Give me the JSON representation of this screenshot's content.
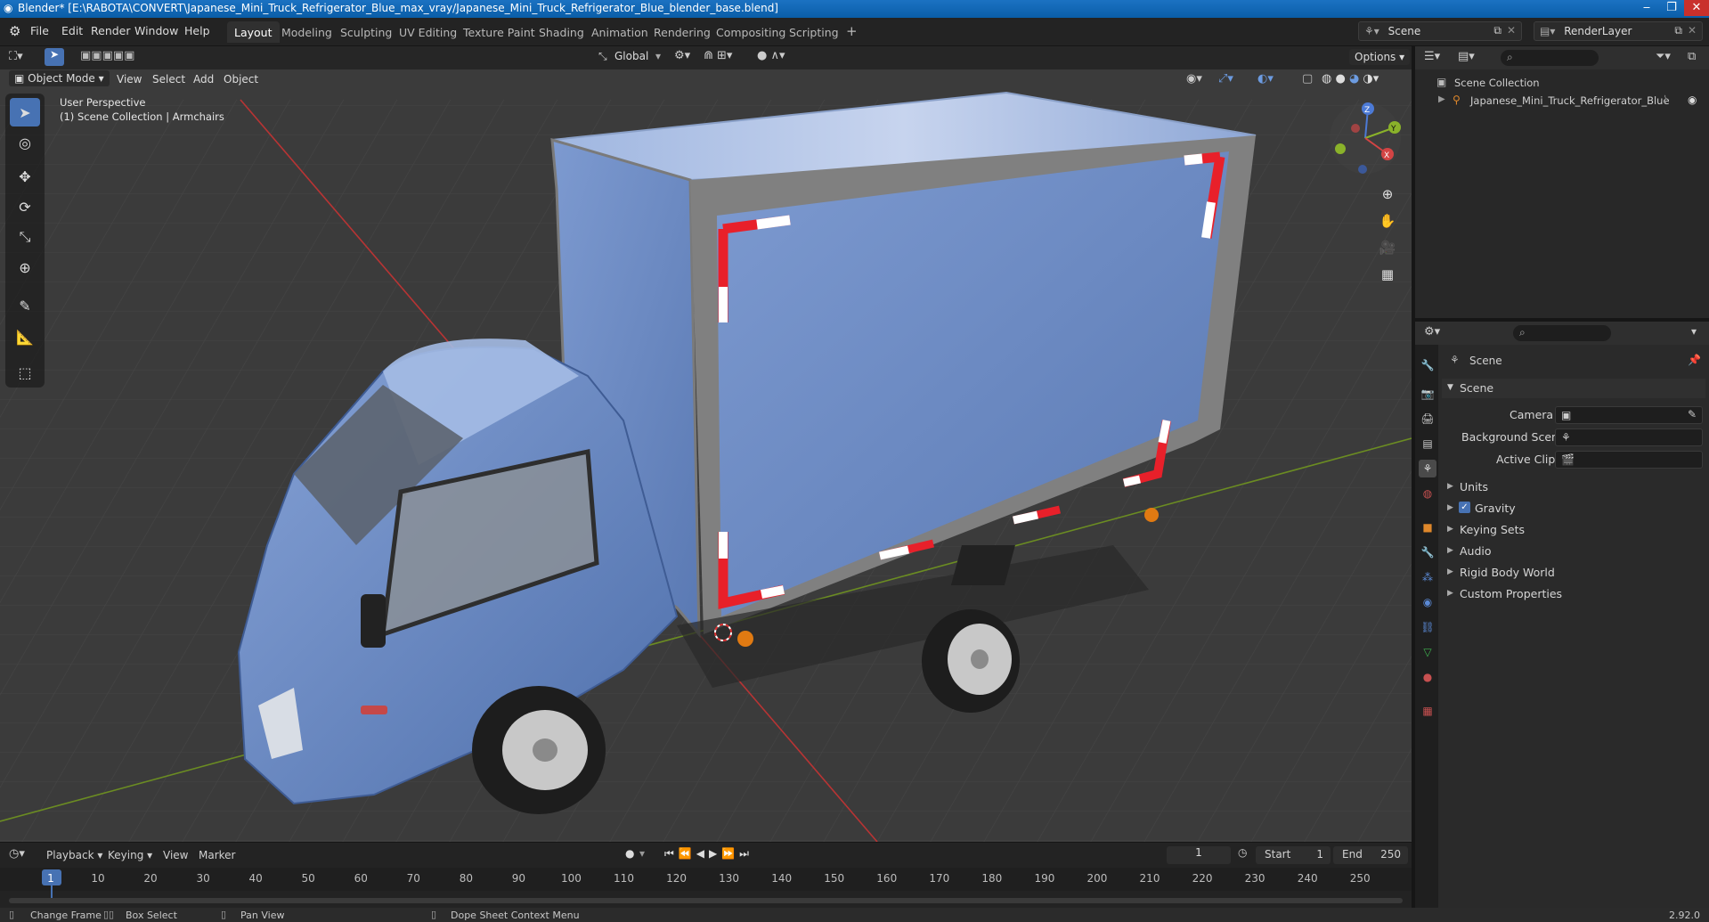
{
  "window": {
    "title": "Blender* [E:\\RABOTA\\CONVERT\\Japanese_Mini_Truck_Refrigerator_Blue_max_vray/Japanese_Mini_Truck_Refrigerator_Blue_blender_base.blend]",
    "minimize": "‒",
    "maximize": "❐",
    "close": "✕"
  },
  "menu": {
    "items": [
      "File",
      "Edit",
      "Render",
      "Window",
      "Help"
    ]
  },
  "workspaces": [
    "Layout",
    "Modeling",
    "Sculpting",
    "UV Editing",
    "Texture Paint",
    "Shading",
    "Animation",
    "Rendering",
    "Compositing",
    "Scripting"
  ],
  "active_workspace": "Layout",
  "add_workspace": "+",
  "scene_selector": {
    "value": "Scene"
  },
  "renderlayer_selector": {
    "value": "RenderLayer"
  },
  "viewport_header": {
    "transform_orientation": "Global",
    "options": "Options",
    "mode": "Object Mode",
    "menus": [
      "View",
      "Select",
      "Add",
      "Object"
    ]
  },
  "viewport": {
    "perspective": "User Perspective",
    "collection_info": "(1) Scene Collection | Armchairs",
    "gizmo": {
      "z": "Z",
      "y": "Y",
      "x": "X"
    }
  },
  "outliner": {
    "root": "Scene Collection",
    "items": [
      "Japanese_Mini_Truck_Refrigerator_Blue"
    ]
  },
  "properties": {
    "header": "Scene",
    "section": "Scene",
    "fields": [
      {
        "label": "Camera"
      },
      {
        "label": "Background Scene"
      },
      {
        "label": "Active Clip"
      }
    ],
    "panels": [
      "Units",
      "Gravity",
      "Keying Sets",
      "Audio",
      "Rigid Body World",
      "Custom Properties"
    ],
    "gravity_checked": true
  },
  "timeline": {
    "menus": [
      "Playback",
      "Keying",
      "View",
      "Marker"
    ],
    "current_frame": "1",
    "start_label": "Start",
    "start": "1",
    "end_label": "End",
    "end": "250",
    "ruler": [
      "1",
      "10",
      "20",
      "30",
      "40",
      "50",
      "60",
      "70",
      "80",
      "90",
      "100",
      "110",
      "120",
      "130",
      "140",
      "150",
      "160",
      "170",
      "180",
      "190",
      "200",
      "210",
      "220",
      "230",
      "240",
      "250"
    ]
  },
  "statusbar": {
    "items": [
      "Change Frame",
      "Box Select",
      "Pan View",
      "Dope Sheet Context Menu"
    ],
    "version": "2.92.0"
  },
  "colors": {
    "accent": "#4772b3",
    "truck_blue": "#6f8fc8",
    "axis_x": "#c83a3a",
    "axis_y": "#6e9a2a"
  }
}
